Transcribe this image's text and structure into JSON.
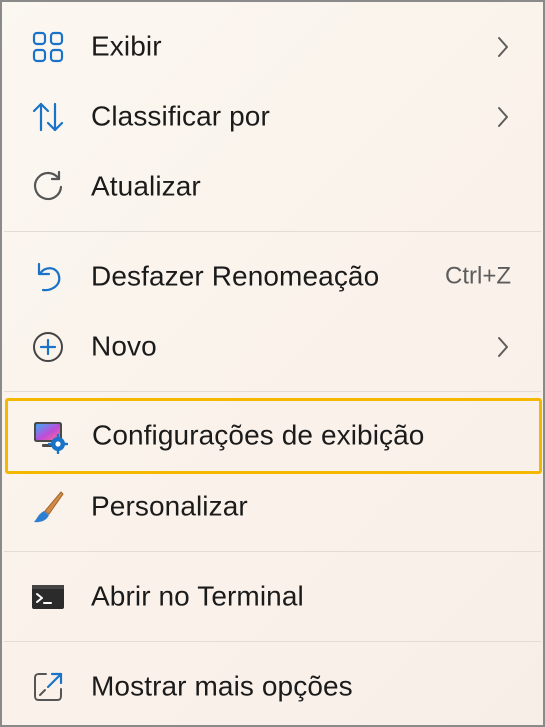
{
  "menu": {
    "items": [
      {
        "label": "Exibir",
        "icon": "view-grid-icon",
        "submenu": true
      },
      {
        "label": "Classificar por",
        "icon": "sort-icon",
        "submenu": true
      },
      {
        "label": "Atualizar",
        "icon": "refresh-icon",
        "submenu": false
      },
      {
        "label": "Desfazer Renomeação",
        "icon": "undo-icon",
        "shortcut": "Ctrl+Z"
      },
      {
        "label": "Novo",
        "icon": "new-plus-icon",
        "submenu": true
      },
      {
        "label": "Configurações de exibição",
        "icon": "display-settings-icon",
        "highlighted": true
      },
      {
        "label": "Personalizar",
        "icon": "paintbrush-icon"
      },
      {
        "label": "Abrir no Terminal",
        "icon": "terminal-icon"
      },
      {
        "label": "Mostrar mais opções",
        "icon": "show-more-options-icon"
      }
    ]
  },
  "colors": {
    "accent_blue": "#1a73c9",
    "highlight_border": "#f5b800",
    "separator": "#e2dcd6"
  }
}
